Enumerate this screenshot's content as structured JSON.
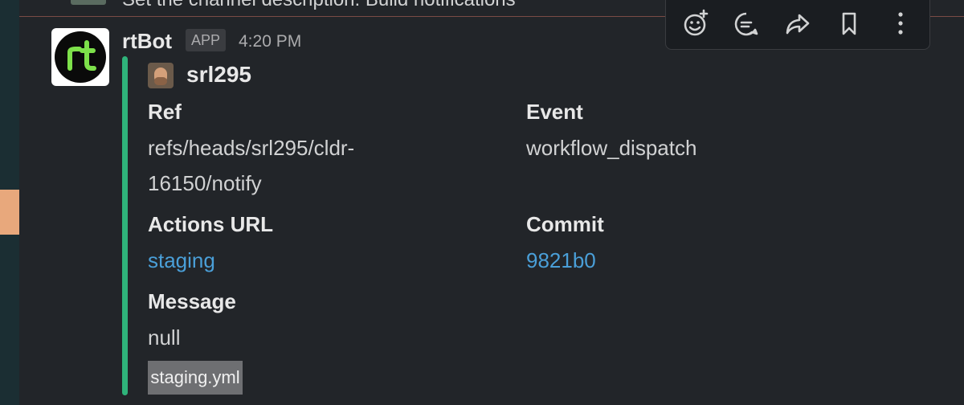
{
  "previous_message": {
    "text": "Set the channel description: Build notifications"
  },
  "message": {
    "sender": "rtBot",
    "badge": "APP",
    "time": "4:20 PM",
    "attachment": {
      "author": "srl295",
      "fields": [
        {
          "title": "Ref",
          "value_line1": "refs/heads/srl295/cldr-",
          "value_line2": "16150/notify"
        },
        {
          "title": "Event",
          "value": "workflow_dispatch"
        },
        {
          "title": "Actions URL",
          "value": "staging"
        },
        {
          "title": "Commit",
          "value": "9821b0"
        },
        {
          "title": "Message",
          "value": "null"
        }
      ],
      "footer_file": "staging.yml"
    }
  },
  "toolbar": {
    "icons": [
      "add-reaction-icon",
      "reply-in-thread-icon",
      "share-icon",
      "bookmark-icon",
      "more-actions-icon"
    ]
  },
  "colors": {
    "background": "#222529",
    "attachment_bar": "#2fb37a",
    "link": "#4a9fd8",
    "accent": "#e8a87c"
  }
}
